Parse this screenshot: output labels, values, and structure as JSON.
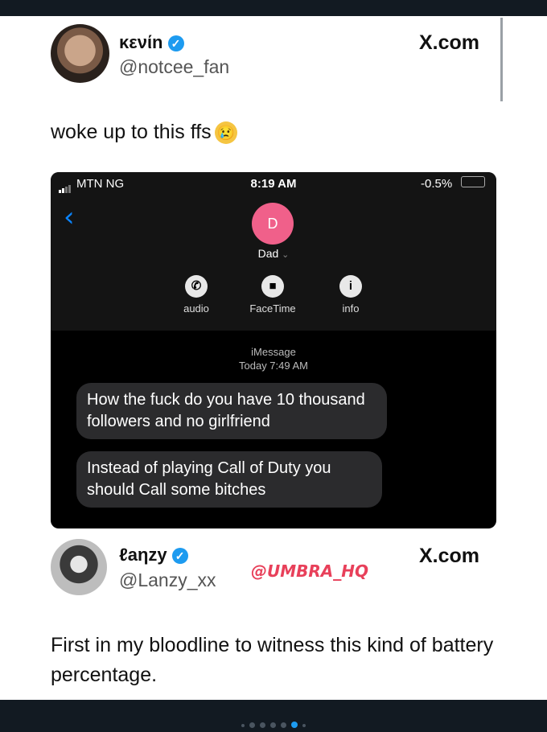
{
  "tweet1": {
    "name": "κενίn",
    "handle": "@notcee_fan",
    "site": "X.com",
    "text": "woke up to this ffs"
  },
  "imessage": {
    "carrier": "MTN NG",
    "time": "8:19 AM",
    "battery": "-0.5%",
    "contact_initial": "D",
    "contact_name": "Dad",
    "actions": [
      "audio",
      "FaceTime",
      "info"
    ],
    "service": "iMessage",
    "timestamp": "Today 7:49 AM",
    "messages": [
      "How the fuck do you have 10 thousand followers and no girlfriend",
      "Instead of playing Call of Duty you should Call some bitches"
    ]
  },
  "tweet2": {
    "name": "ℓaηzy",
    "handle": "@Lanzy_xx",
    "site": "X.com",
    "watermark": "@UMBRA_HQ",
    "text": "First in my bloodline to witness this kind of battery percentage."
  },
  "colors": {
    "verified": "#1d9bf0",
    "imessage_back": "#0a84ff",
    "contact_avatar": "#f0608a",
    "watermark": "#e8405a"
  }
}
